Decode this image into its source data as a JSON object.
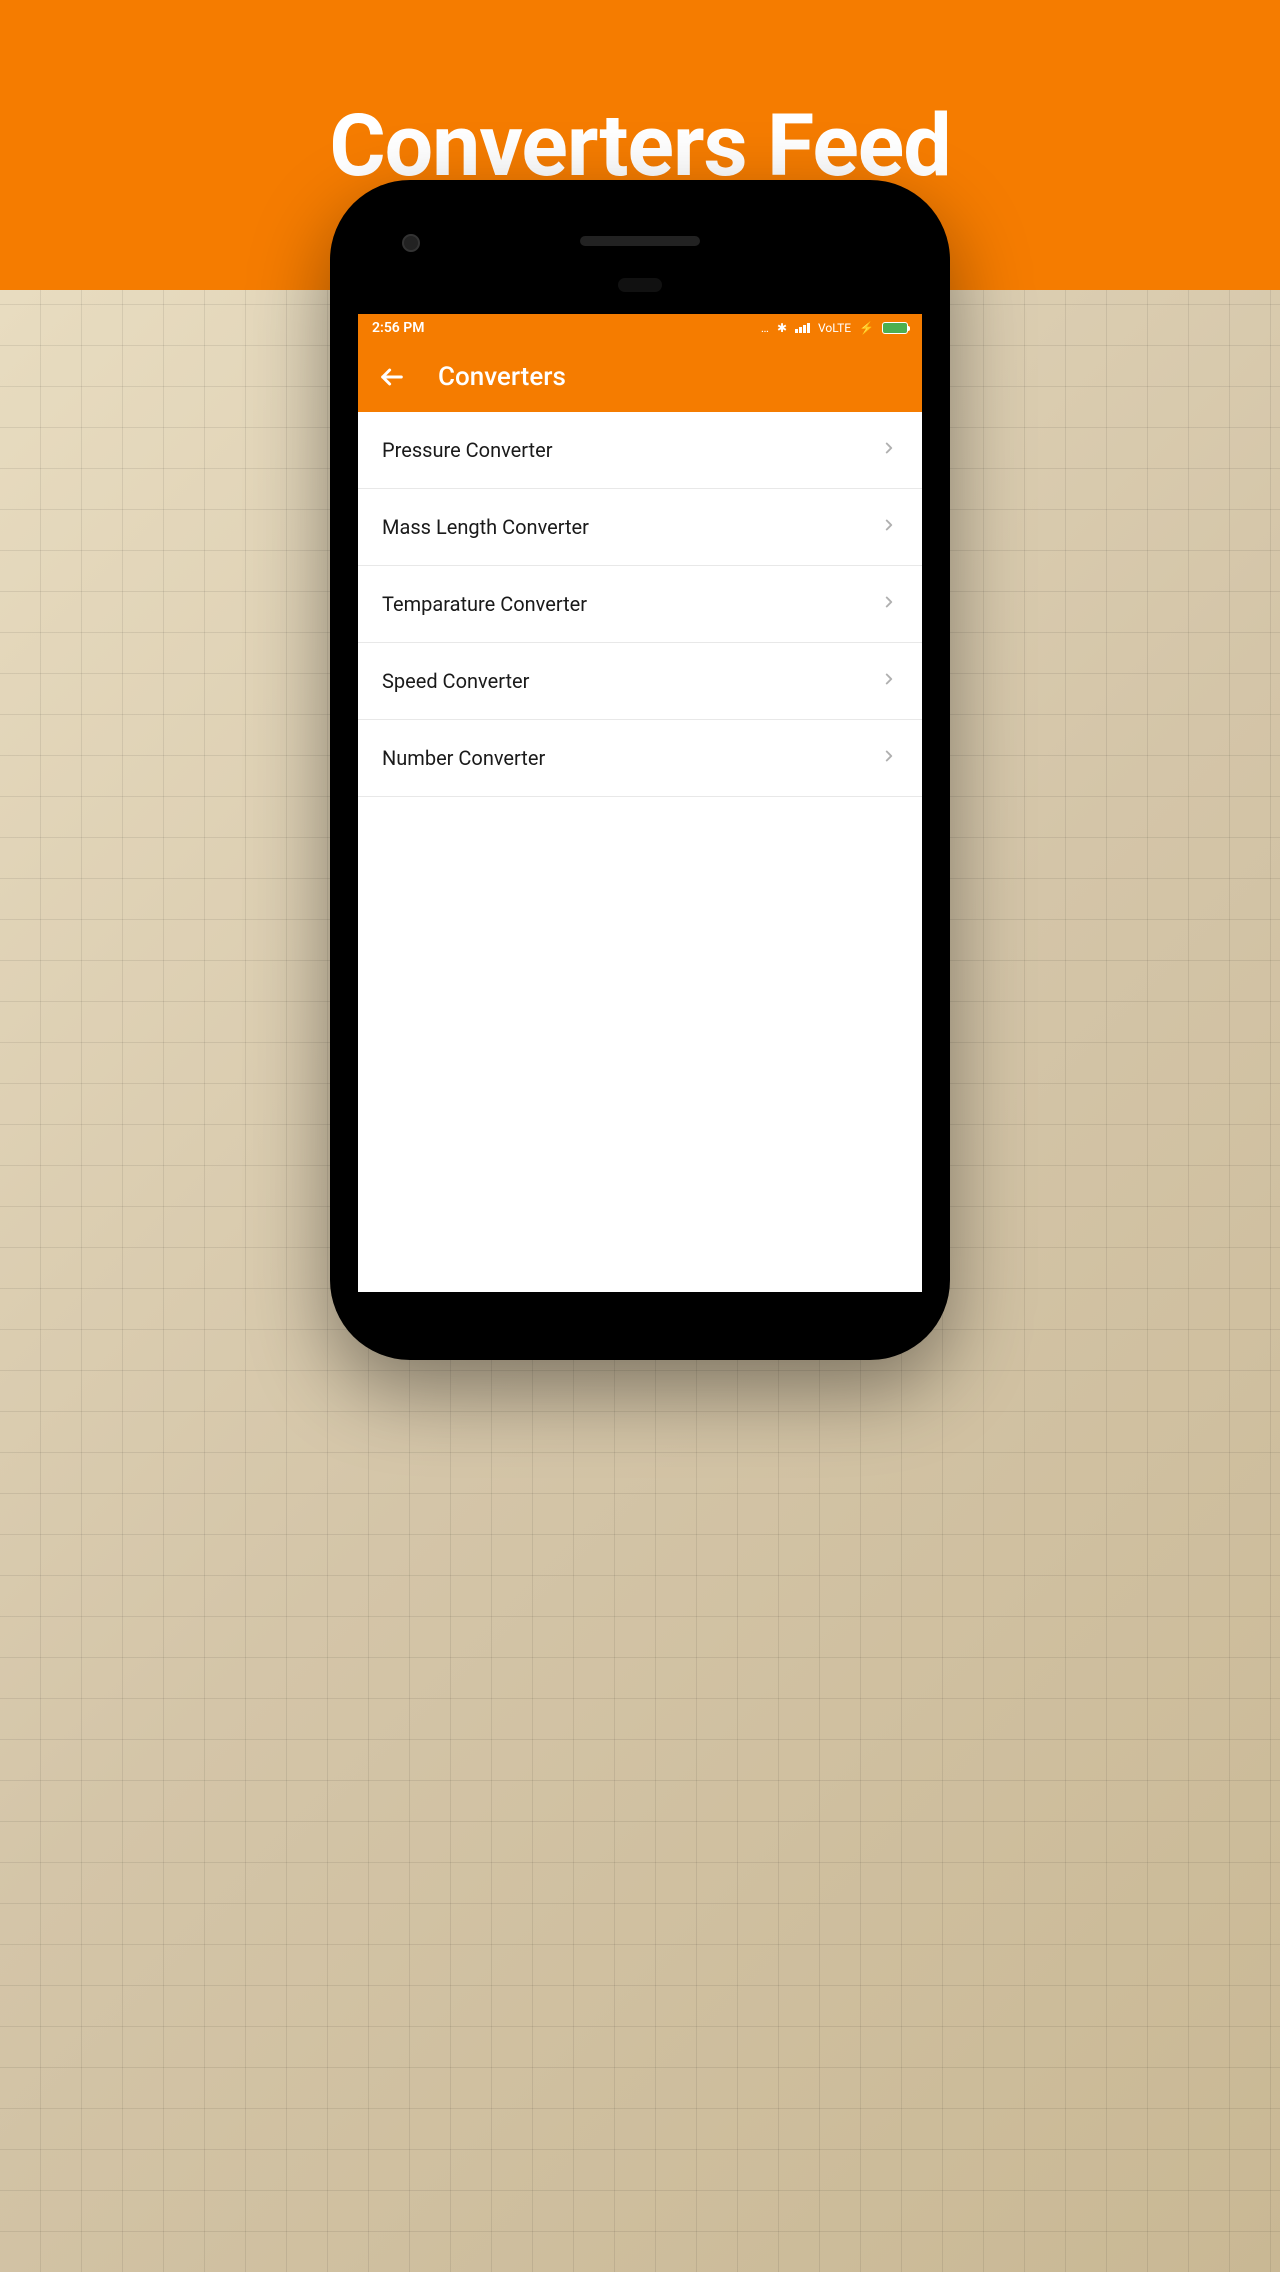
{
  "header": {
    "title": "Converters Feed"
  },
  "statusBar": {
    "time": "2:56 PM",
    "networkLabel": "VoLTE",
    "dots": "…",
    "bluetooth": "✱",
    "charging": "⚡"
  },
  "appBar": {
    "title": "Converters"
  },
  "list": {
    "items": [
      {
        "label": "Pressure Converter"
      },
      {
        "label": "Mass Length Converter"
      },
      {
        "label": "Temparature Converter"
      },
      {
        "label": "Speed Converter"
      },
      {
        "label": "Number Converter"
      }
    ]
  }
}
